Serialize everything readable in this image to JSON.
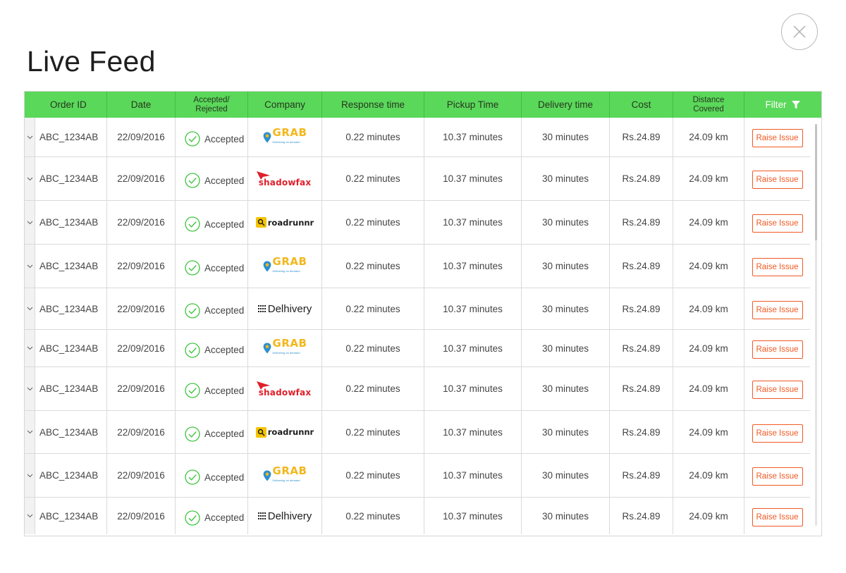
{
  "page": {
    "title": "Live Feed"
  },
  "colors": {
    "header_bg": "#5ad85a",
    "accent_orange": "#f05a23",
    "accept_green": "#3cc43c"
  },
  "table": {
    "headers": {
      "order_id": "Order ID",
      "date": "Date",
      "status_line1": "Accepted/",
      "status_line2": "Rejected",
      "company": "Company",
      "response": "Response time",
      "pickup": "Pickup Time",
      "delivery": "Delivery time",
      "cost": "Cost",
      "distance_line1": "Distance",
      "distance_line2": "Covered",
      "filter": "Filter"
    },
    "rows": [
      {
        "order_id": "ABC_1234AB",
        "date": "22/09/2016",
        "status": "Accepted",
        "company": "grab",
        "response": "0.22 minutes",
        "pickup": "10.37 minutes",
        "delivery": "30 minutes",
        "cost": "Rs.24.89",
        "distance": "24.09 km",
        "action": "Raise Issue"
      },
      {
        "order_id": "ABC_1234AB",
        "date": "22/09/2016",
        "status": "Accepted",
        "company": "shadowfax",
        "response": "0.22 minutes",
        "pickup": "10.37 minutes",
        "delivery": "30 minutes",
        "cost": "Rs.24.89",
        "distance": "24.09 km",
        "action": "Raise Issue"
      },
      {
        "order_id": "ABC_1234AB",
        "date": "22/09/2016",
        "status": "Accepted",
        "company": "roadrunnr",
        "response": "0.22 minutes",
        "pickup": "10.37 minutes",
        "delivery": "30 minutes",
        "cost": "Rs.24.89",
        "distance": "24.09 km",
        "action": "Raise Issue"
      },
      {
        "order_id": "ABC_1234AB",
        "date": "22/09/2016",
        "status": "Accepted",
        "company": "grab",
        "response": "0.22 minutes",
        "pickup": "10.37 minutes",
        "delivery": "30 minutes",
        "cost": "Rs.24.89",
        "distance": "24.09 km",
        "action": "Raise Issue"
      },
      {
        "order_id": "ABC_1234AB",
        "date": "22/09/2016",
        "status": "Accepted",
        "company": "delhivery",
        "response": "0.22 minutes",
        "pickup": "10.37 minutes",
        "delivery": "30 minutes",
        "cost": "Rs.24.89",
        "distance": "24.09 km",
        "action": "Raise Issue"
      },
      {
        "order_id": "ABC_1234AB",
        "date": "22/09/2016",
        "status": "Accepted",
        "company": "grab",
        "response": "0.22 minutes",
        "pickup": "10.37 minutes",
        "delivery": "30 minutes",
        "cost": "Rs.24.89",
        "distance": "24.09 km",
        "action": "Raise Issue"
      },
      {
        "order_id": "ABC_1234AB",
        "date": "22/09/2016",
        "status": "Accepted",
        "company": "shadowfax",
        "response": "0.22 minutes",
        "pickup": "10.37 minutes",
        "delivery": "30 minutes",
        "cost": "Rs.24.89",
        "distance": "24.09 km",
        "action": "Raise Issue"
      },
      {
        "order_id": "ABC_1234AB",
        "date": "22/09/2016",
        "status": "Accepted",
        "company": "roadrunnr",
        "response": "0.22 minutes",
        "pickup": "10.37 minutes",
        "delivery": "30 minutes",
        "cost": "Rs.24.89",
        "distance": "24.09 km",
        "action": "Raise Issue"
      },
      {
        "order_id": "ABC_1234AB",
        "date": "22/09/2016",
        "status": "Accepted",
        "company": "grab",
        "response": "0.22 minutes",
        "pickup": "10.37 minutes",
        "delivery": "30 minutes",
        "cost": "Rs.24.89",
        "distance": "24.09 km",
        "action": "Raise Issue"
      },
      {
        "order_id": "ABC_1234AB",
        "date": "22/09/2016",
        "status": "Accepted",
        "company": "delhivery",
        "response": "0.22 minutes",
        "pickup": "10.37 minutes",
        "delivery": "30 minutes",
        "cost": "Rs.24.89",
        "distance": "24.09 km",
        "action": "Raise Issue"
      }
    ]
  },
  "logos": {
    "grab": {
      "text": "GRAB",
      "tagline": "Delivering on demand"
    },
    "shadowfax": {
      "text": "shadowfax"
    },
    "roadrunnr": {
      "text": "roadrunnr"
    },
    "delhivery": {
      "text": "Delhivery"
    }
  },
  "icons": {
    "close": "close-icon",
    "filter": "filter-icon",
    "expand": "chevron-down-icon",
    "accepted": "check-circle-icon"
  }
}
